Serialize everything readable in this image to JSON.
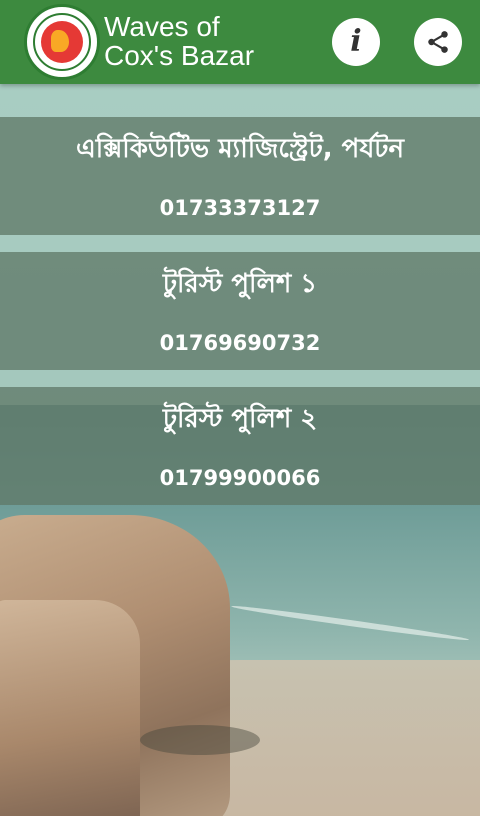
{
  "app": {
    "title_line1": "Waves of",
    "title_line2": "Cox's Bazar"
  },
  "header": {
    "info_icon": "info-icon",
    "share_icon": "share-icon"
  },
  "colors": {
    "app_bar": "#3d8a3f",
    "card_bg": "#607a69"
  },
  "contacts": [
    {
      "name": "এক্সিকিউটিভ ম্যাজিস্ট্রেট, পর্যটন",
      "phone": "01733373127"
    },
    {
      "name": "টুরিস্ট পুলিশ ১",
      "phone": "01769690732"
    },
    {
      "name": "টুরিস্ট পুলিশ ২",
      "phone": "01799900066"
    }
  ]
}
